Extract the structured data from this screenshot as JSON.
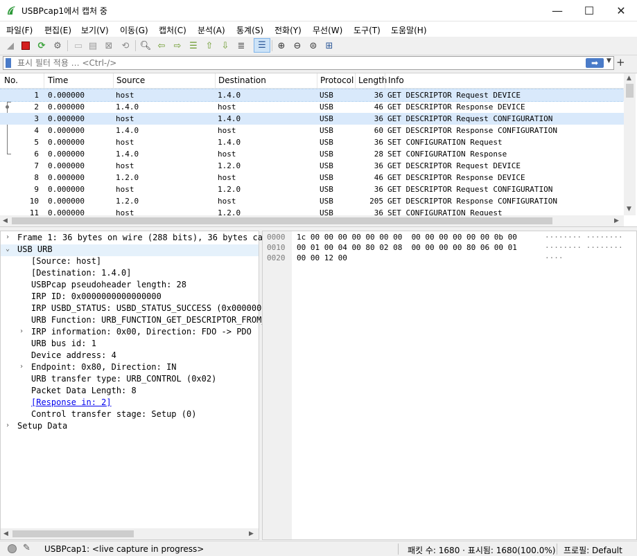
{
  "window": {
    "title": "USBPcap1에서 캡처 중",
    "minimize": "—",
    "maximize": "☐",
    "close": "✕"
  },
  "menu": [
    "파일(F)",
    "편집(E)",
    "보기(V)",
    "이동(G)",
    "캡처(C)",
    "분석(A)",
    "통계(S)",
    "전화(Y)",
    "무선(W)",
    "도구(T)",
    "도움말(H)"
  ],
  "filter": {
    "placeholder": "표시 필터 적용 … <Ctrl-/>",
    "apply": "➡",
    "dropdown": "▼",
    "add": "+"
  },
  "packet_list": {
    "headers": [
      "No.",
      "Time",
      "Source",
      "Destination",
      "Protocol",
      "Length",
      "Info"
    ],
    "rows": [
      [
        "1",
        "0.000000",
        "host",
        "1.4.0",
        "USB",
        "36",
        "GET DESCRIPTOR Request DEVICE"
      ],
      [
        "2",
        "0.000000",
        "1.4.0",
        "host",
        "USB",
        "46",
        "GET DESCRIPTOR Response DEVICE"
      ],
      [
        "3",
        "0.000000",
        "host",
        "1.4.0",
        "USB",
        "36",
        "GET DESCRIPTOR Request CONFIGURATION"
      ],
      [
        "4",
        "0.000000",
        "1.4.0",
        "host",
        "USB",
        "60",
        "GET DESCRIPTOR Response CONFIGURATION"
      ],
      [
        "5",
        "0.000000",
        "host",
        "1.4.0",
        "USB",
        "36",
        "SET CONFIGURATION Request"
      ],
      [
        "6",
        "0.000000",
        "1.4.0",
        "host",
        "USB",
        "28",
        "SET CONFIGURATION Response"
      ],
      [
        "7",
        "0.000000",
        "host",
        "1.2.0",
        "USB",
        "36",
        "GET DESCRIPTOR Request DEVICE"
      ],
      [
        "8",
        "0.000000",
        "1.2.0",
        "host",
        "USB",
        "46",
        "GET DESCRIPTOR Response DEVICE"
      ],
      [
        "9",
        "0.000000",
        "host",
        "1.2.0",
        "USB",
        "36",
        "GET DESCRIPTOR Request CONFIGURATION"
      ],
      [
        "10",
        "0.000000",
        "1.2.0",
        "host",
        "USB",
        "205",
        "GET DESCRIPTOR Response CONFIGURATION"
      ],
      [
        "11",
        "0.000000",
        "host",
        "1.2.0",
        "USB",
        "36",
        "SET CONFIGURATION Request"
      ]
    ]
  },
  "details": [
    {
      "text": "Frame 1: 36 bytes on wire (288 bits), 36 bytes cap",
      "exp": "›"
    },
    {
      "text": "USB URB",
      "exp": "⌄"
    },
    {
      "text": "[Source: host]"
    },
    {
      "text": "[Destination: 1.4.0]"
    },
    {
      "text": "USBPcap pseudoheader length: 28"
    },
    {
      "text": "IRP ID: 0x0000000000000000"
    },
    {
      "text": "IRP USBD_STATUS: USBD_STATUS_SUCCESS (0x0000000"
    },
    {
      "text": "URB Function: URB_FUNCTION_GET_DESCRIPTOR_FROM_"
    },
    {
      "text": "IRP information: 0x00, Direction: FDO -> PDO",
      "exp": "›"
    },
    {
      "text": "URB bus id: 1"
    },
    {
      "text": "Device address: 4"
    },
    {
      "text": "Endpoint: 0x80, Direction: IN",
      "exp": "›"
    },
    {
      "text": "URB transfer type: URB_CONTROL (0x02)"
    },
    {
      "text": "Packet Data Length: 8"
    },
    {
      "text": "[Response in: 2]",
      "link": true
    },
    {
      "text": "Control transfer stage: Setup (0)"
    },
    {
      "text": "Setup Data",
      "exp": "›"
    }
  ],
  "hex": {
    "offsets": [
      "0000",
      "0010",
      "0020"
    ],
    "bytes": [
      "1c 00 00 00 00 00 00 00  00 00 00 00 00 00 0b 00",
      "00 01 00 04 00 80 02 08  00 00 00 00 80 06 00 01",
      "00 00 12 00"
    ],
    "ascii": [
      "········ ········",
      "········ ········",
      "····"
    ]
  },
  "status": {
    "interface": "USBPcap1: <live capture in progress>",
    "counts": "패킷 수: 1680 · 표시됨: 1680(100.0%)",
    "profile": "프로필: Default"
  },
  "colors": {
    "selected_row": "#d9e9fb",
    "accent": "#4a7bc8",
    "stop": "#d42020",
    "restart": "#3aa33a"
  }
}
